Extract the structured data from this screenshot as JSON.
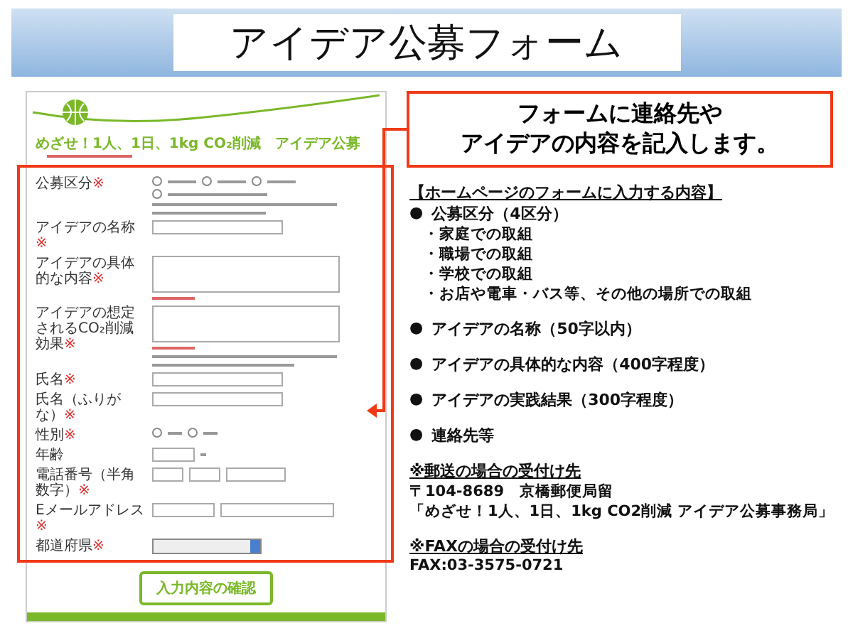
{
  "banner": {
    "title": "アイデア公募フォーム"
  },
  "form": {
    "heading": "めざせ！1人、1日、1kg CO₂削減　アイデア公募",
    "fields": [
      {
        "label": "公募区分",
        "mark": "※",
        "kind": "radio"
      },
      {
        "label": "アイデアの名称",
        "mark": "※",
        "kind": "text"
      },
      {
        "label": "アイデアの具体的な内容",
        "mark": "※",
        "kind": "textarea"
      },
      {
        "label": "アイデアの想定されるCO₂削減効果",
        "mark": "※",
        "kind": "textarea_note"
      },
      {
        "label": "氏名",
        "mark": "※",
        "kind": "text"
      },
      {
        "label": "氏名（ふりがな）",
        "mark": "※",
        "kind": "text"
      },
      {
        "label": "性別",
        "mark": "※",
        "kind": "gender"
      },
      {
        "label": "年齢",
        "kind": "age"
      },
      {
        "label": "電話番号（半角数字）",
        "mark": "※",
        "kind": "phone"
      },
      {
        "label": "Eメールアドレス",
        "mark": "※",
        "kind": "email"
      },
      {
        "label": "都道府県",
        "mark": "※",
        "kind": "select"
      }
    ],
    "confirm_button": "入力内容の確認"
  },
  "callout": {
    "lines": [
      "フォームに連絡先や",
      "アイデアの内容を記入します。"
    ]
  },
  "contents": {
    "heading": "【ホームページのフォームに入力する内容】",
    "items": [
      {
        "bullet": "●",
        "text": "公募区分（4区分）",
        "children": [
          {
            "text": "・家庭での取組"
          },
          {
            "text": "・職場での取組"
          },
          {
            "text": "・学校での取組"
          },
          {
            "text": "・お店や電車・バス等、その他の場所での取組"
          }
        ]
      },
      {
        "bullet": "●",
        "text": "アイデアの名称（50字以内）"
      },
      {
        "bullet": "●",
        "text": "アイデアの具体的な内容（400字程度）"
      },
      {
        "bullet": "●",
        "text": "アイデアの実践結果（300字程度）"
      },
      {
        "bullet": "●",
        "text": "連絡先等"
      }
    ]
  },
  "mail": {
    "heading": "※郵送の場合の受付け先",
    "lines": [
      "〒104-8689　京橋郵便局留",
      "「めざせ！1人、1日、1kg CO2削減 アイデア公募事務局」"
    ]
  },
  "fax": {
    "heading": "※FAXの場合の受付け先",
    "lines": [
      "FAX:03-3575-0721"
    ]
  }
}
